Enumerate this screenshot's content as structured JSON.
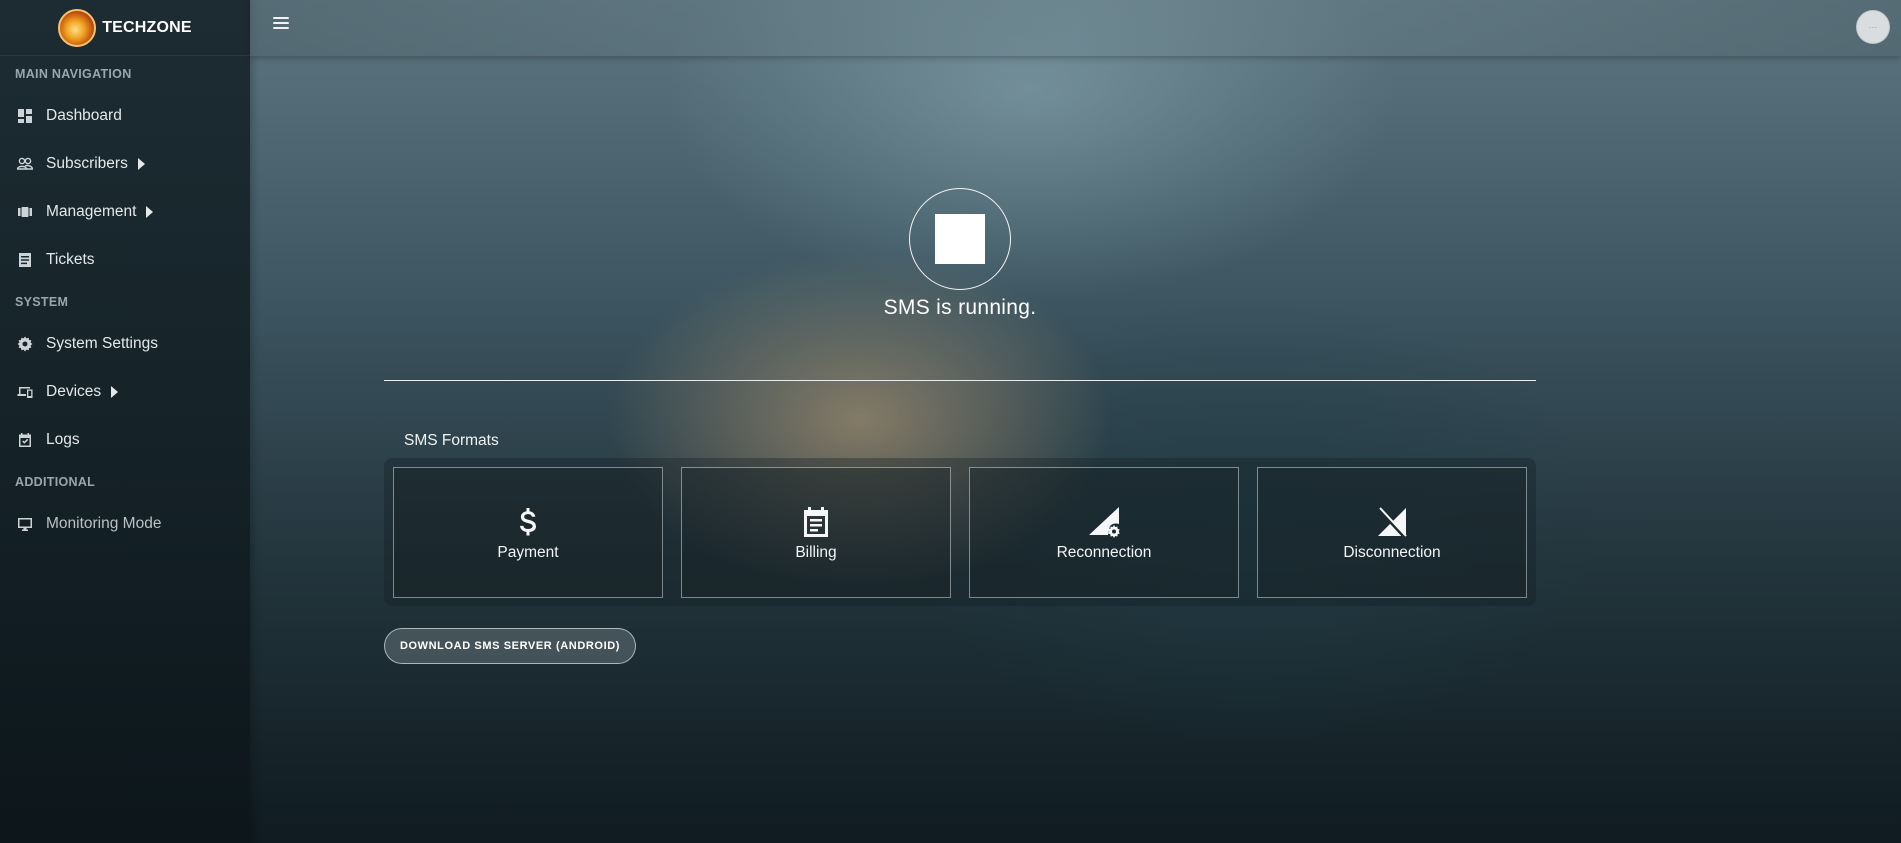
{
  "brand": {
    "name": "TECHZONE"
  },
  "sidebar": {
    "sections": [
      {
        "label": "MAIN NAVIGATION"
      },
      {
        "label": "SYSTEM"
      },
      {
        "label": "ADDITIONAL"
      }
    ],
    "items": [
      {
        "label": "Dashboard",
        "icon": "dashboard-icon"
      },
      {
        "label": "Subscribers",
        "icon": "users-icon",
        "expandable": true
      },
      {
        "label": "Management",
        "icon": "management-icon",
        "expandable": true
      },
      {
        "label": "Tickets",
        "icon": "tickets-icon"
      },
      {
        "label": "System Settings",
        "icon": "gear-icon"
      },
      {
        "label": "Devices",
        "icon": "devices-icon",
        "expandable": true
      },
      {
        "label": "Logs",
        "icon": "logs-icon"
      },
      {
        "label": "Monitoring Mode",
        "icon": "monitor-icon"
      }
    ]
  },
  "main": {
    "status_text": "SMS is running.",
    "formats_title": "SMS Formats",
    "formats": [
      {
        "label": "Payment",
        "icon": "dollar-icon"
      },
      {
        "label": "Billing",
        "icon": "calendar-icon"
      },
      {
        "label": "Reconnection",
        "icon": "signal-settings-icon"
      },
      {
        "label": "Disconnection",
        "icon": "signal-off-icon"
      }
    ],
    "download_label": "DOWNLOAD SMS SERVER (ANDROID)"
  },
  "colors": {
    "sidebar_bg": "#17252b",
    "text": "#e3e8eb",
    "section_label": "#9aa6ac"
  }
}
